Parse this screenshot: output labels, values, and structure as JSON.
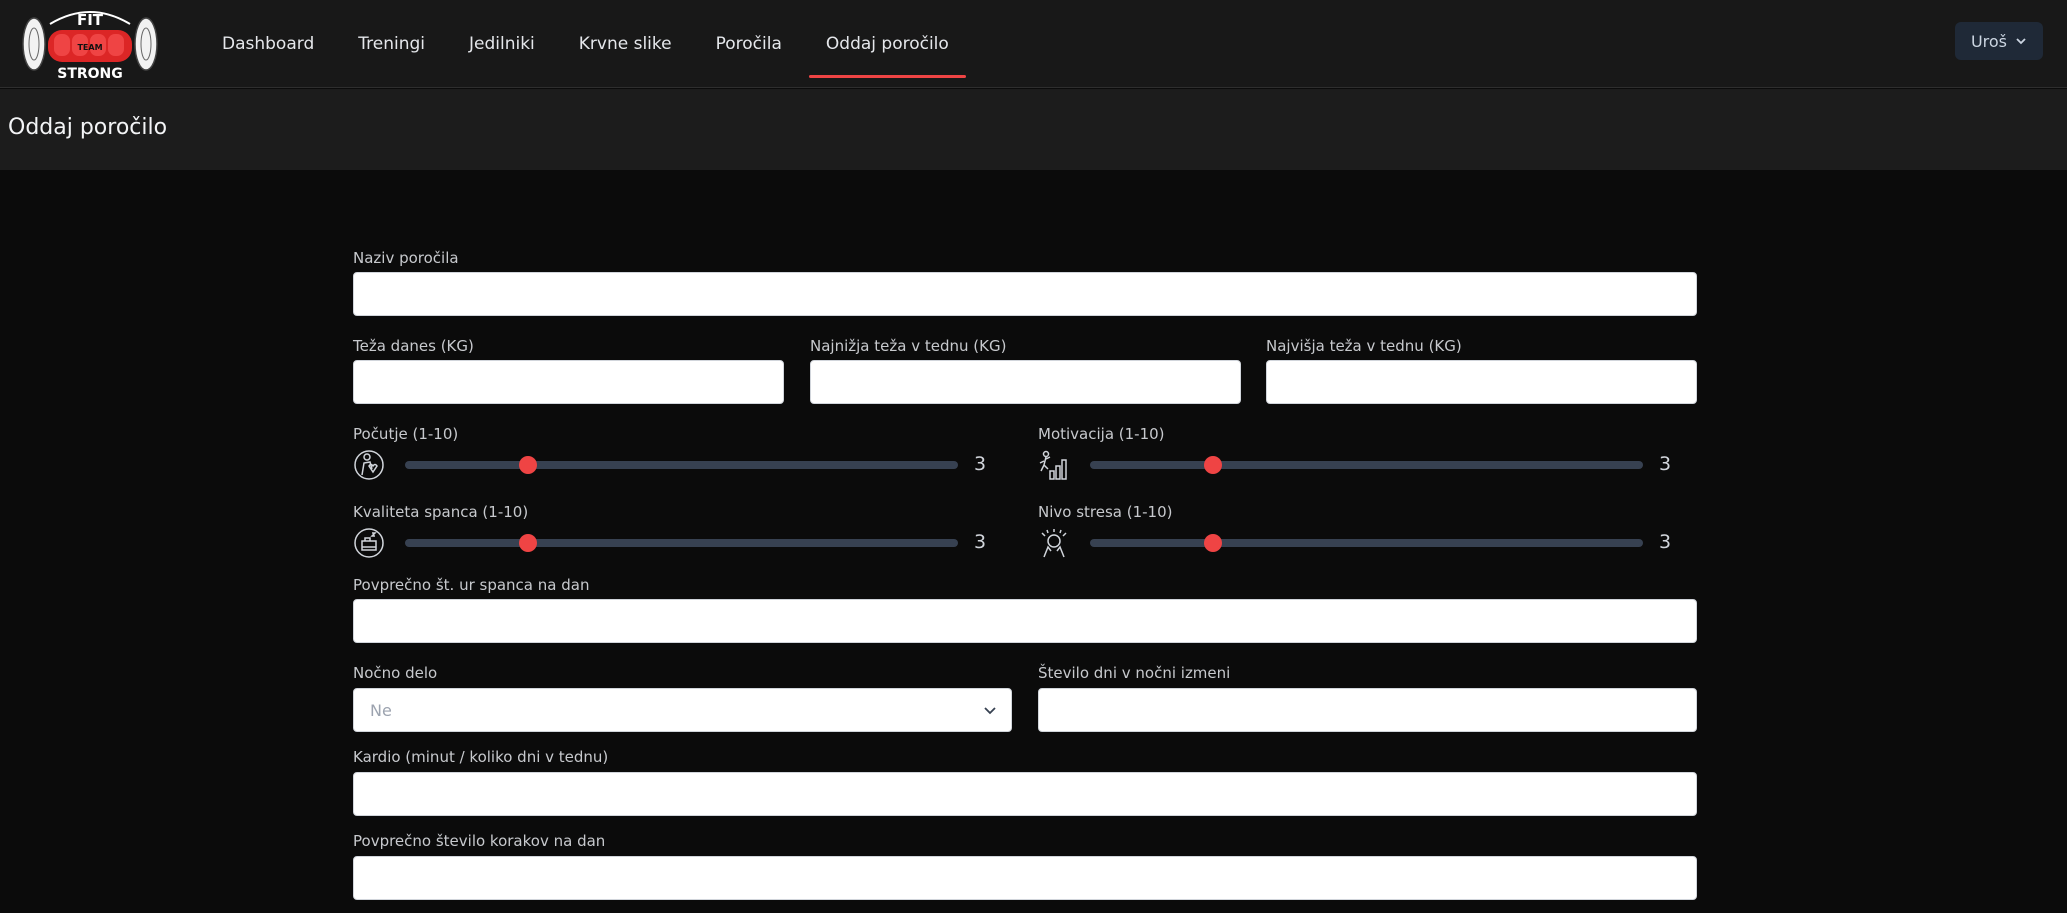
{
  "nav": {
    "items": [
      {
        "label": "Dashboard"
      },
      {
        "label": "Treningi"
      },
      {
        "label": "Jedilniki"
      },
      {
        "label": "Krvne slike"
      },
      {
        "label": "Poročila"
      },
      {
        "label": "Oddaj poročilo"
      }
    ],
    "active_index": 5,
    "user_label": "Uroš"
  },
  "logo": {
    "top": "FIT",
    "middle": "TEAM",
    "bottom": "STRONG"
  },
  "page": {
    "title": "Oddaj poročilo"
  },
  "form": {
    "report_name": {
      "label": "Naziv poročila",
      "value": ""
    },
    "weight_today": {
      "label": "Teža danes (KG)",
      "value": ""
    },
    "weight_min": {
      "label": "Najnižja teža v tednu (KG)",
      "value": ""
    },
    "weight_max": {
      "label": "Najvišja teža v tednu (KG)",
      "value": ""
    },
    "wellbeing": {
      "label": "Počutje (1-10)",
      "value": 3,
      "min": 1,
      "max": 10,
      "icon": "wellbeing-icon"
    },
    "motivation": {
      "label": "Motivacija (1-10)",
      "value": 3,
      "min": 1,
      "max": 10,
      "icon": "motivation-icon"
    },
    "sleep_quality": {
      "label": "Kvaliteta spanca (1-10)",
      "value": 3,
      "min": 1,
      "max": 10,
      "icon": "sleep-quality-icon"
    },
    "stress": {
      "label": "Nivo stresa (1-10)",
      "value": 3,
      "min": 1,
      "max": 10,
      "icon": "stress-icon"
    },
    "sleep_hours": {
      "label": "Povprečno št. ur spanca na dan",
      "value": ""
    },
    "night_work": {
      "label": "Nočno delo",
      "selected": "Ne"
    },
    "night_days": {
      "label": "Število dni v nočni izmeni",
      "value": ""
    },
    "cardio": {
      "label": "Kardio (minut / koliko dni v tednu)",
      "value": ""
    },
    "steps": {
      "label": "Povprečno število korakov na dan",
      "value": ""
    }
  },
  "colors": {
    "accent": "#ef4444",
    "track": "#374151",
    "nav_bg": "#181818",
    "page_bg": "#0b0b0b"
  }
}
